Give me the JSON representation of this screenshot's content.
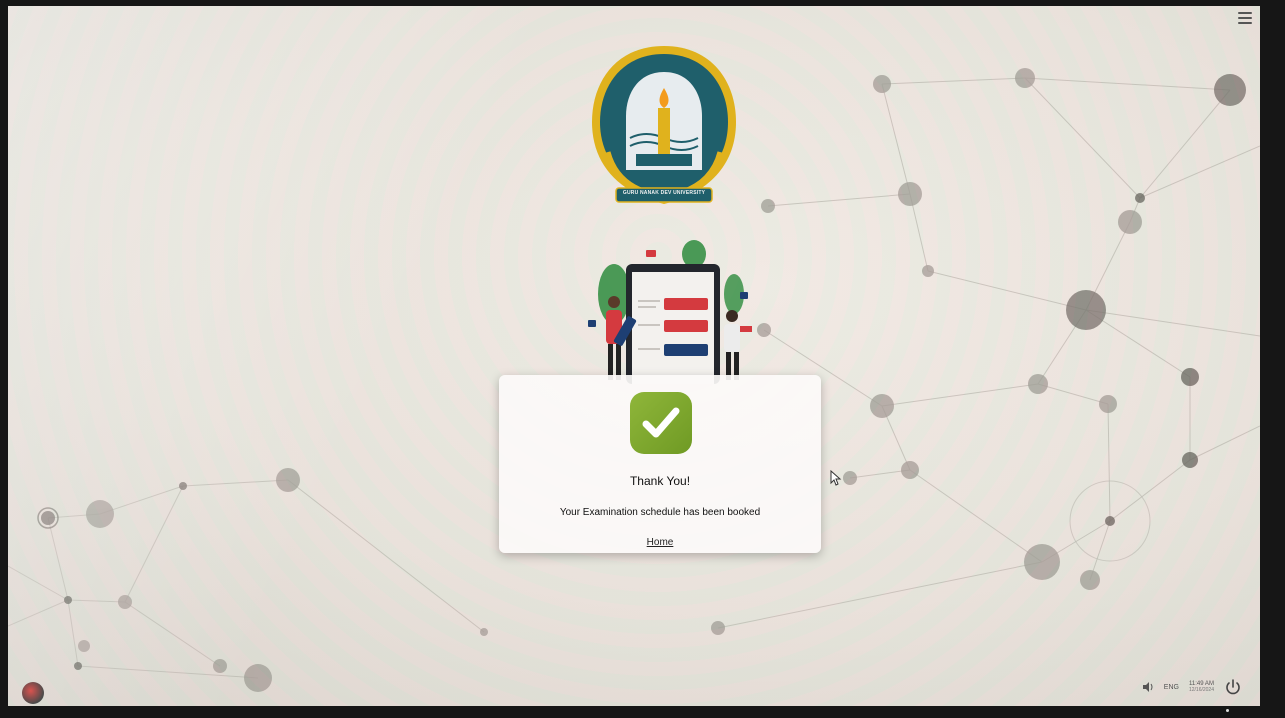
{
  "dialog": {
    "title": "Thank You!",
    "message": "Your Examination schedule has been booked",
    "home_link": "Home"
  },
  "logo": {
    "institution_name": "GURU NANAK DEV UNIVERSITY",
    "icon": "university-emblem"
  },
  "tray": {
    "language": "ENG",
    "time": "11:49 AM",
    "date": "12/16/2024"
  },
  "icons": {
    "menu": "hamburger-menu-icon",
    "success": "checkmark-icon",
    "volume": "speaker-icon",
    "power": "power-icon",
    "start": "start-orb-icon",
    "cursor": "mouse-pointer-icon"
  },
  "colors": {
    "success_badge": "#7aa62c",
    "logo_teal": "#1f5f6b",
    "logo_gold": "#e0b21d",
    "dialog_bg": "#fcfaf8"
  }
}
